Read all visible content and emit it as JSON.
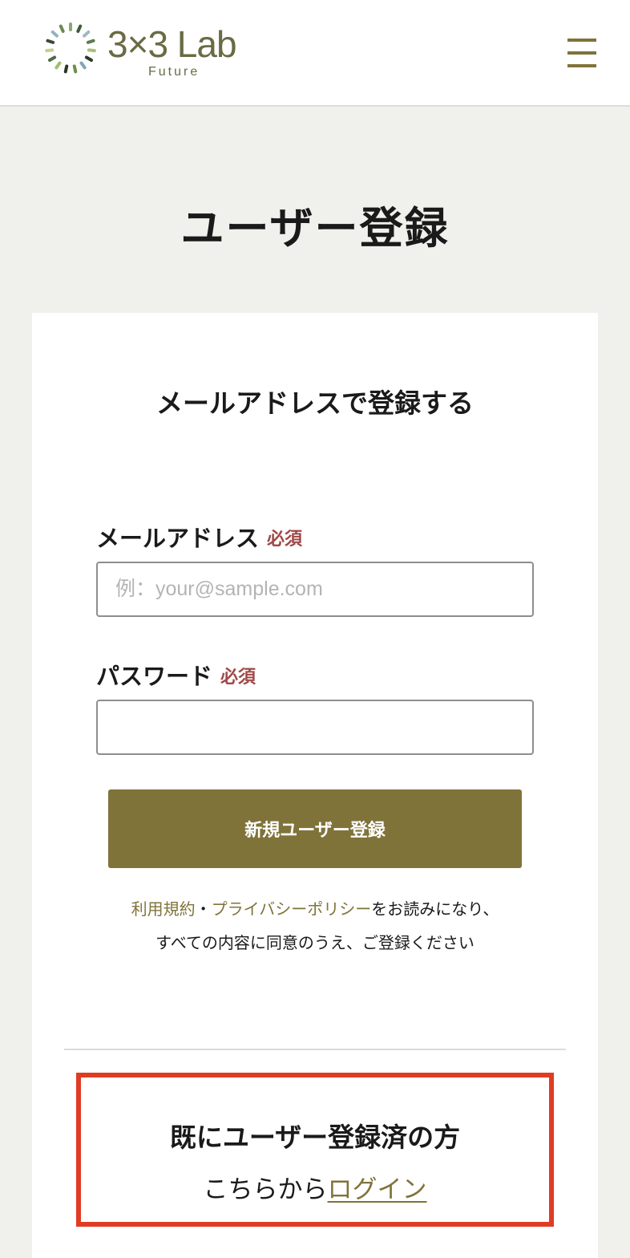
{
  "header": {
    "logo_text": "3×3 Lab",
    "logo_sub": "Future",
    "brand_color": "#80733a"
  },
  "page_title": "ユーザー登録",
  "form": {
    "section_title": "メールアドレスで登録する",
    "email_label": "メールアドレス",
    "email_required": "必須",
    "email_placeholder": "例：your@sample.com",
    "email_value": "",
    "password_label": "パスワード",
    "password_required": "必須",
    "password_value": "",
    "submit_label": "新規ユーザー登録",
    "terms_link": "利用規約",
    "separator": "・",
    "privacy_link": "プライバシーポリシー",
    "agreement_text_1": "をお読みになり、",
    "agreement_text_2": "すべての内容に同意のうえ、ご登録ください",
    "required_color": "#a04848"
  },
  "login": {
    "title": "既にユーザー登録済の方",
    "prefix": "こちらから",
    "link_label": "ログイン",
    "highlight_color": "#e03c24"
  }
}
